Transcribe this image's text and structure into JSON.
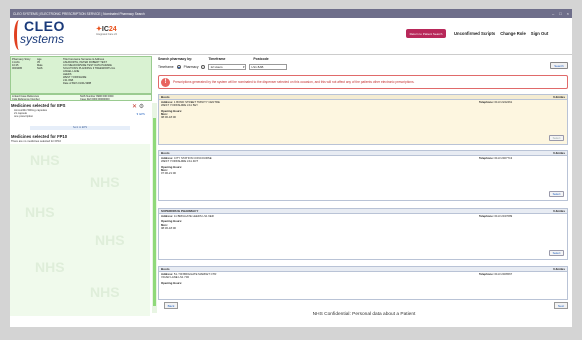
{
  "window": {
    "title": "CLEO SYSTEMS | ELECTRONIC PRESCRIPTION SERVICE | Nominated Pharmacy Search",
    "controls": [
      "–",
      "□",
      "×"
    ]
  },
  "header": {
    "logo_line1": "CLEO",
    "logo_line2": "systems",
    "ic24_prefix": "IC",
    "ic24_number": "24",
    "ic24_sub": "Integrated Care 24",
    "return_button": "Return to Patient Search",
    "nav": [
      "Unconfirmed Scripts",
      "Change Role",
      "Sign Out"
    ]
  },
  "patient": {
    "col_a": [
      "Pharmacy Story",
      "4 AUG",
      "10:25",
      "0003486"
    ],
    "col_b": [
      "Age",
      "35",
      "Male",
      "NHS"
    ],
    "col_c": [
      "Title Forename Surname & Address",
      "ASHWORTH, PETER ROBERT TEST",
      "",
      "C/O MEADOWSIDE TEST DATA PARADE",
      "SOLUTIONS PLANNING 3 TREEWORTH AL",
      "ANGEL LANE",
      "LEEDS",
      "WEST YORKSHIRE",
      "LS1 8AB",
      "Date of Birth 01/01/1988"
    ],
    "id1": "Linked Case Reference",
    "id2": "NHS Number 9990 000 0000",
    "id3": "CLE Reference Number",
    "id4": "Case Ref 0000 00000000"
  },
  "meds": {
    "heading1": "Medicines selected for EPS",
    "list1": [
      "Amoxicillin 500mg capsules",
      "21 capsule",
      "one prescription"
    ],
    "link": "▼ EPS",
    "sent": "Sent to EPS",
    "heading2": "Medicines selected for FP10",
    "sub2": "There are no medicines selected for FP10",
    "watermark": "NHS"
  },
  "search": {
    "heading_main": "Search pharmacy by:",
    "heading_timeframe": "Timeframe",
    "heading_postcode": "Postcode",
    "radio_timeframe": "Timeframe",
    "radio_pharmacy": "Pharmacy",
    "timeframe_value": "12 Hours",
    "postcode_value": "LS1 8AB",
    "button": "Search"
  },
  "warning": {
    "text": "Prescriptions generated by the system will be nominated to the dispenser selected on this occasion, and this will not affect any of the patients other electronic prescriptions."
  },
  "pharmacies": [
    {
      "name": "Boots",
      "distance": "0.2miles",
      "address": "1 BOND STREET TRINITY CENTRE",
      "address2": "WEST YORKSHIRE LS1 5EY",
      "telephone": "0113 2242461",
      "opening_label": "Opening Hours:",
      "day": "Mon:",
      "hours": "08:00-18:00",
      "button": "Select"
    },
    {
      "name": "Boots",
      "distance": "0.3miles",
      "address": "CITY STATION CONCOURSE",
      "address2": "WEST YORKSHIRE LS1 4DT",
      "telephone": "0113 2467713",
      "opening_label": "Opening Hours:",
      "day": "Mon:",
      "hours": "07:00-21:00",
      "button": "Select"
    },
    {
      "name": "SUPERDRUG PHARMACY",
      "distance": "0.3miles",
      "address": "11 BRIGGATE LEEDS LS1 6ER",
      "address2": "",
      "telephone": "0113 2437089",
      "opening_label": "Opening Hours:",
      "day": "Mon:",
      "hours": "08:30-18:00",
      "button": "Select"
    },
    {
      "name": "Boots",
      "distance": "0.3miles",
      "address": "51 / 59 BRIGGATE MARKET CTR",
      "address2": "VICAR LANE LS1 7JD",
      "telephone": "0113 2466567",
      "opening_label": "Opening Hours:",
      "day": "",
      "hours": "",
      "button": ""
    }
  ],
  "nav_buttons": {
    "back": "Back",
    "next": "Next"
  },
  "footer": "NHS Confidential: Personal data about a Patient",
  "colors": {
    "accent": "#b8285a",
    "patient_bg": "#d9f2d2",
    "warning": "#e06a6a"
  }
}
